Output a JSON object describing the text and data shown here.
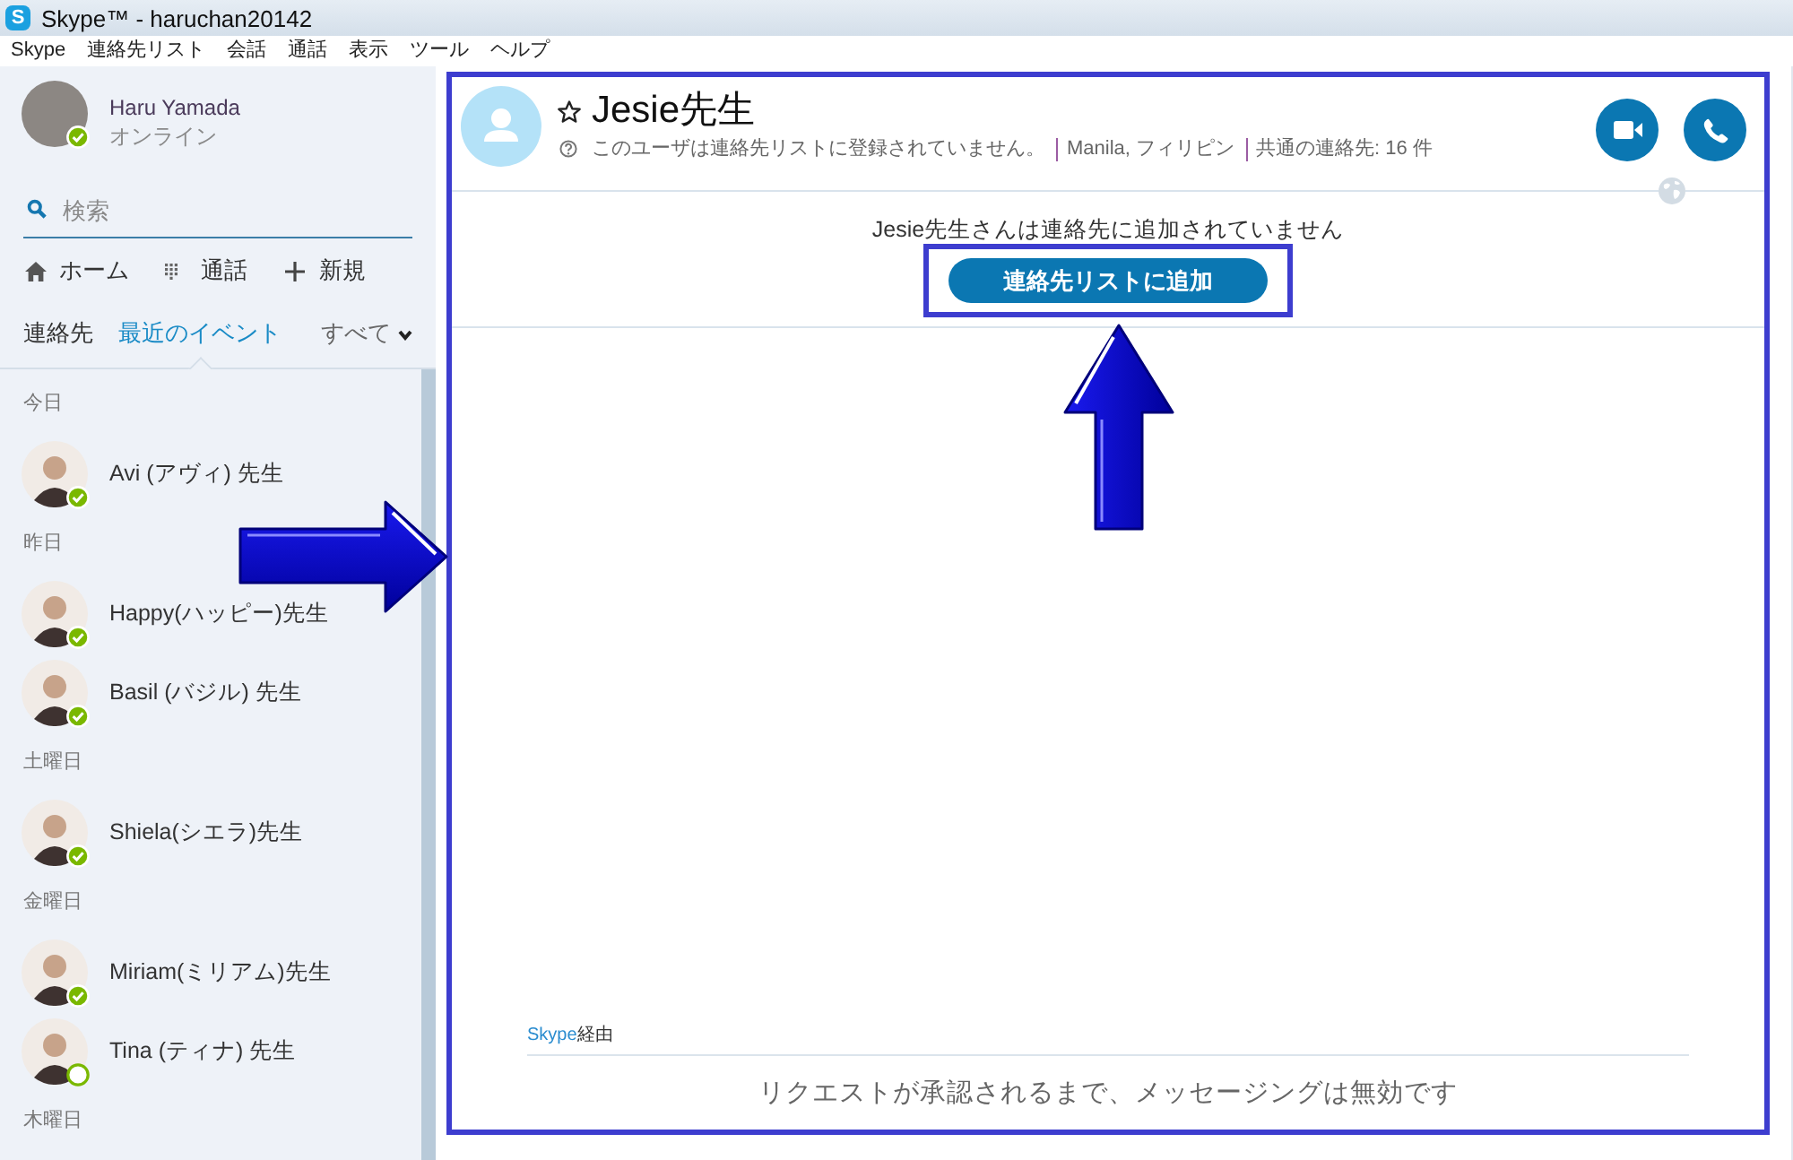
{
  "window": {
    "logo": "S",
    "title": "Skype™ - haruchan20142"
  },
  "menu": [
    "Skype",
    "連絡先リスト",
    "会話",
    "通話",
    "表示",
    "ツール",
    "ヘルプ"
  ],
  "profile": {
    "name": "Haru Yamada",
    "status": "オンライン",
    "online": true
  },
  "search": {
    "placeholder": "検索"
  },
  "nav": [
    {
      "kind": "home",
      "label": "ホーム"
    },
    {
      "kind": "dialpad",
      "label": "通話"
    },
    {
      "kind": "new",
      "label": "新規"
    }
  ],
  "tabs": [
    {
      "label": "連絡先",
      "selected": false
    },
    {
      "label": "最近のイベント",
      "selected": true
    }
  ],
  "filter": {
    "label": "すべて"
  },
  "recent": [
    {
      "heading": "今日",
      "contacts": [
        {
          "name": "Avi (アヴィ) 先生",
          "online": true
        }
      ]
    },
    {
      "heading": "昨日",
      "contacts": [
        {
          "name": "Happy(ハッピー)先生",
          "online": true
        },
        {
          "name": "Basil (バジル) 先生",
          "online": true
        }
      ]
    },
    {
      "heading": "土曜日",
      "contacts": [
        {
          "name": "Shiela(シエラ)先生",
          "online": true
        }
      ]
    },
    {
      "heading": "金曜日",
      "contacts": [
        {
          "name": "Miriam(ミリアム)先生",
          "online": true
        },
        {
          "name": "Tina (ティナ) 先生",
          "online": false
        }
      ]
    },
    {
      "heading": "木曜日"
    }
  ],
  "conversation": {
    "name": "Jesie先生",
    "favorite": false,
    "details": [
      "このユーザは連絡先リストに登録されていません。",
      "Manila, フィリピン",
      "共通の連絡先: 16 件"
    ],
    "notice": "Jesie先生さんは連絡先に追加されていません",
    "add_button": "連絡先リストに追加",
    "via": {
      "service": "Skype",
      "label": "経由"
    },
    "composer_notice": "リクエストが承認されるまで、メッセージングは無効です"
  }
}
